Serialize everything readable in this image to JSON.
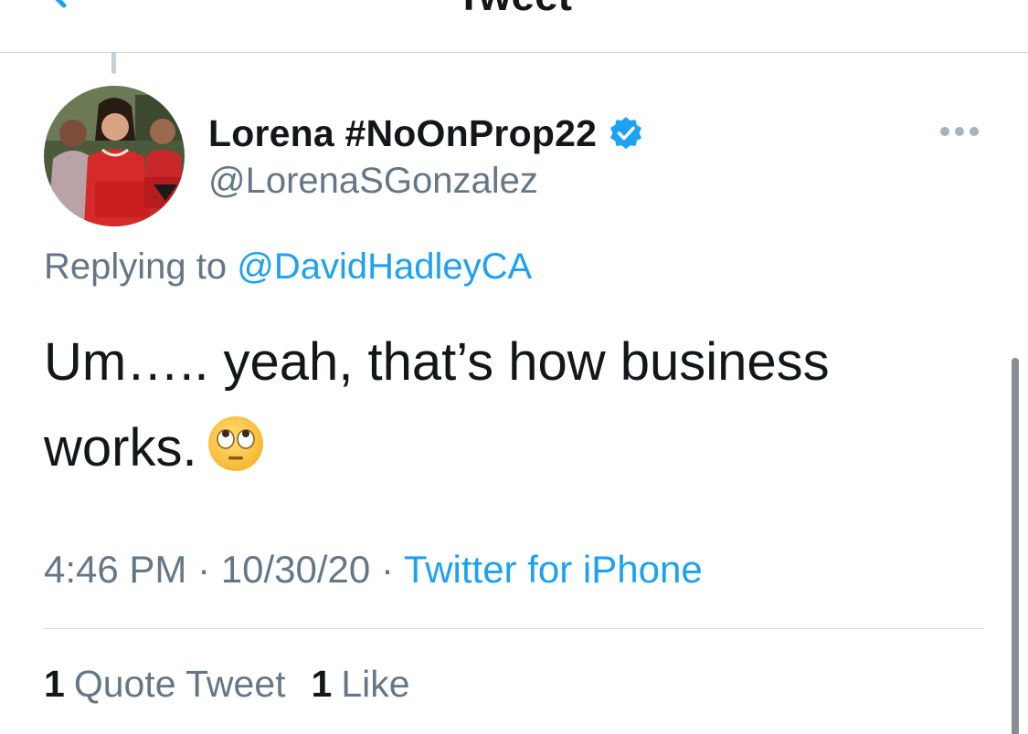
{
  "nav": {
    "title": "Tweet",
    "back_icon": "chevron-left-icon"
  },
  "tweet": {
    "author": {
      "display_name": "Lorena #NoOnProp22",
      "handle": "@LorenaSGonzalez",
      "verified": true
    },
    "replying_prefix": "Replying to",
    "replying_to": "@DavidHadleyCA",
    "text_line1": "Um….. yeah, that’s how business",
    "text_line2": "works.",
    "emoji": "face-with-rolling-eyes",
    "time": "4:46 PM",
    "date": "10/30/20",
    "separator": "·",
    "source": "Twitter for iPhone",
    "stats": {
      "quote_count": "1",
      "quote_label": "Quote Tweet",
      "like_count": "1",
      "like_label": "Like"
    }
  },
  "colors": {
    "accent": "#1da1f2",
    "secondary_text": "#657786",
    "primary_text": "#14171a",
    "divider": "#d6d9db"
  }
}
